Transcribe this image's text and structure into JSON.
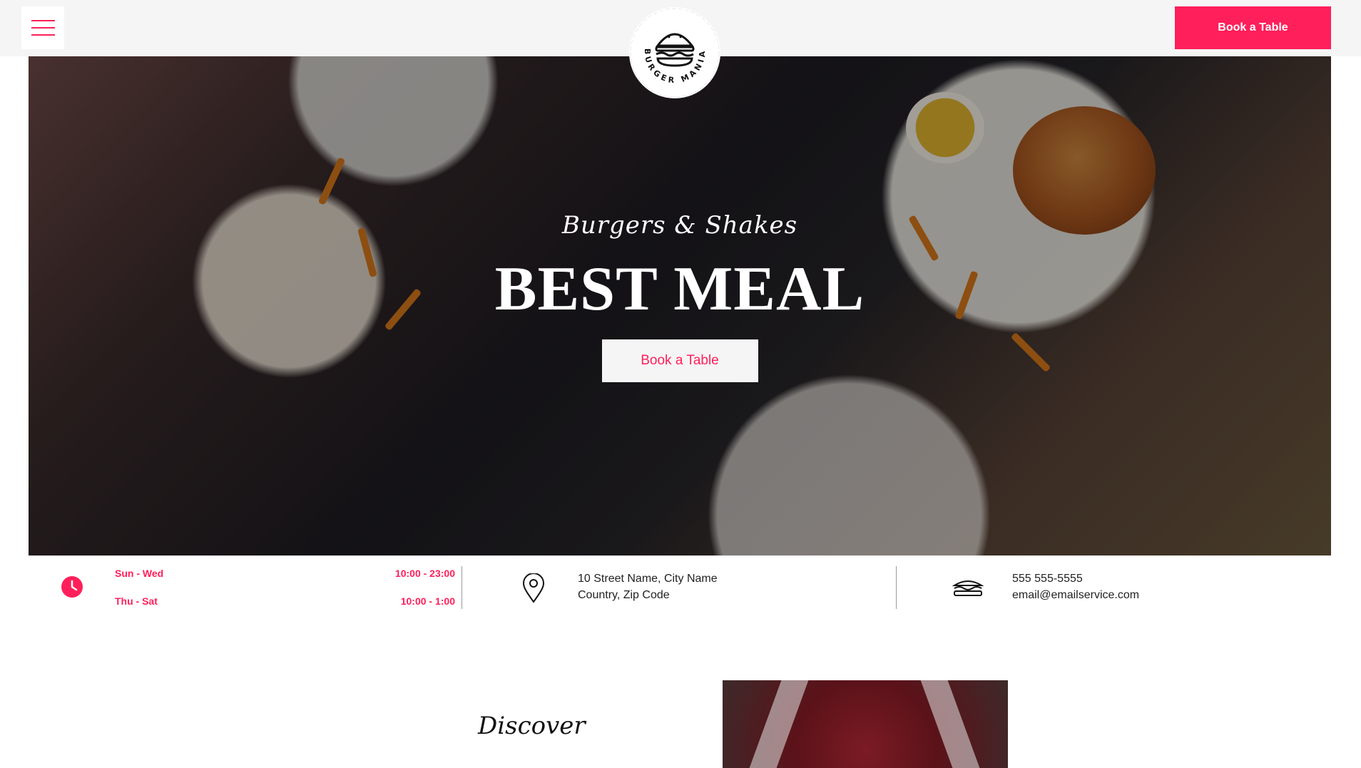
{
  "header": {
    "book_label": "Book a Table",
    "logo_text": "BURGER MANIA",
    "accent_color": "#ff1f5a"
  },
  "hero": {
    "subtitle": "Burgers & Shakes",
    "title": "BEST MEAL",
    "button_label": "Book a Table"
  },
  "info": {
    "hours": [
      {
        "day": "Sun - Wed",
        "time": "10:00 - 23:00"
      },
      {
        "day": "Thu - Sat",
        "time": "10:00 - 1:00"
      }
    ],
    "address": [
      "10 Street Name, City Name",
      "Country, Zip Code"
    ],
    "contact": [
      "555 555-5555",
      "email@emailservice.com"
    ]
  },
  "discover": {
    "title": "Discover"
  },
  "icons": [
    "menu-icon",
    "burger-logo-icon",
    "clock-icon",
    "map-pin-icon",
    "sandwich-icon"
  ]
}
